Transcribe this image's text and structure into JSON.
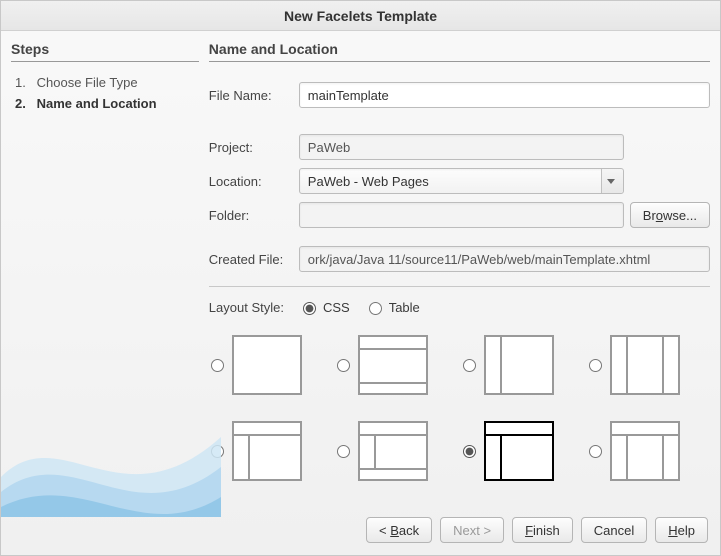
{
  "window": {
    "title": "New Facelets Template"
  },
  "sidebar": {
    "heading": "Steps",
    "steps": [
      {
        "num": "1.",
        "label": "Choose File Type",
        "current": false
      },
      {
        "num": "2.",
        "label": "Name and Location",
        "current": true
      }
    ]
  },
  "main": {
    "heading": "Name and Location",
    "file_name_label": "File Name:",
    "file_name_value": "mainTemplate",
    "project_label": "Project:",
    "project_value": "PaWeb",
    "location_label": "Location:",
    "location_value": "PaWeb - Web Pages",
    "folder_label": "Folder:",
    "folder_value": "",
    "browse_label": "Browse...",
    "created_label": "Created File:",
    "created_value": "ork/java/Java 11/source11/PaWeb/web/mainTemplate.xhtml",
    "layout_style_label": "Layout Style:",
    "layout_css_label": "CSS",
    "layout_table_label": "Table",
    "layout_style_selected": "css",
    "layouts": [
      {
        "id": "blank",
        "header": false,
        "footer": false,
        "left": false,
        "right": false,
        "selected": false
      },
      {
        "id": "hf",
        "header": true,
        "footer": true,
        "left": false,
        "right": false,
        "selected": false
      },
      {
        "id": "l",
        "header": false,
        "footer": false,
        "left": true,
        "right": false,
        "selected": false
      },
      {
        "id": "lr",
        "header": false,
        "footer": false,
        "left": true,
        "right": true,
        "selected": false
      },
      {
        "id": "hl",
        "header": true,
        "footer": false,
        "left": true,
        "right": false,
        "selected": false
      },
      {
        "id": "hfl",
        "header": true,
        "footer": true,
        "left": true,
        "right": false,
        "selected": false
      },
      {
        "id": "hl-full",
        "header": true,
        "footer": false,
        "left": true,
        "right": false,
        "selected": true
      },
      {
        "id": "hlr",
        "header": true,
        "footer": false,
        "left": true,
        "right": true,
        "selected": false
      }
    ]
  },
  "buttons": {
    "back": "< Back",
    "next": "Next >",
    "finish": "Finish",
    "cancel": "Cancel",
    "help": "Help"
  }
}
